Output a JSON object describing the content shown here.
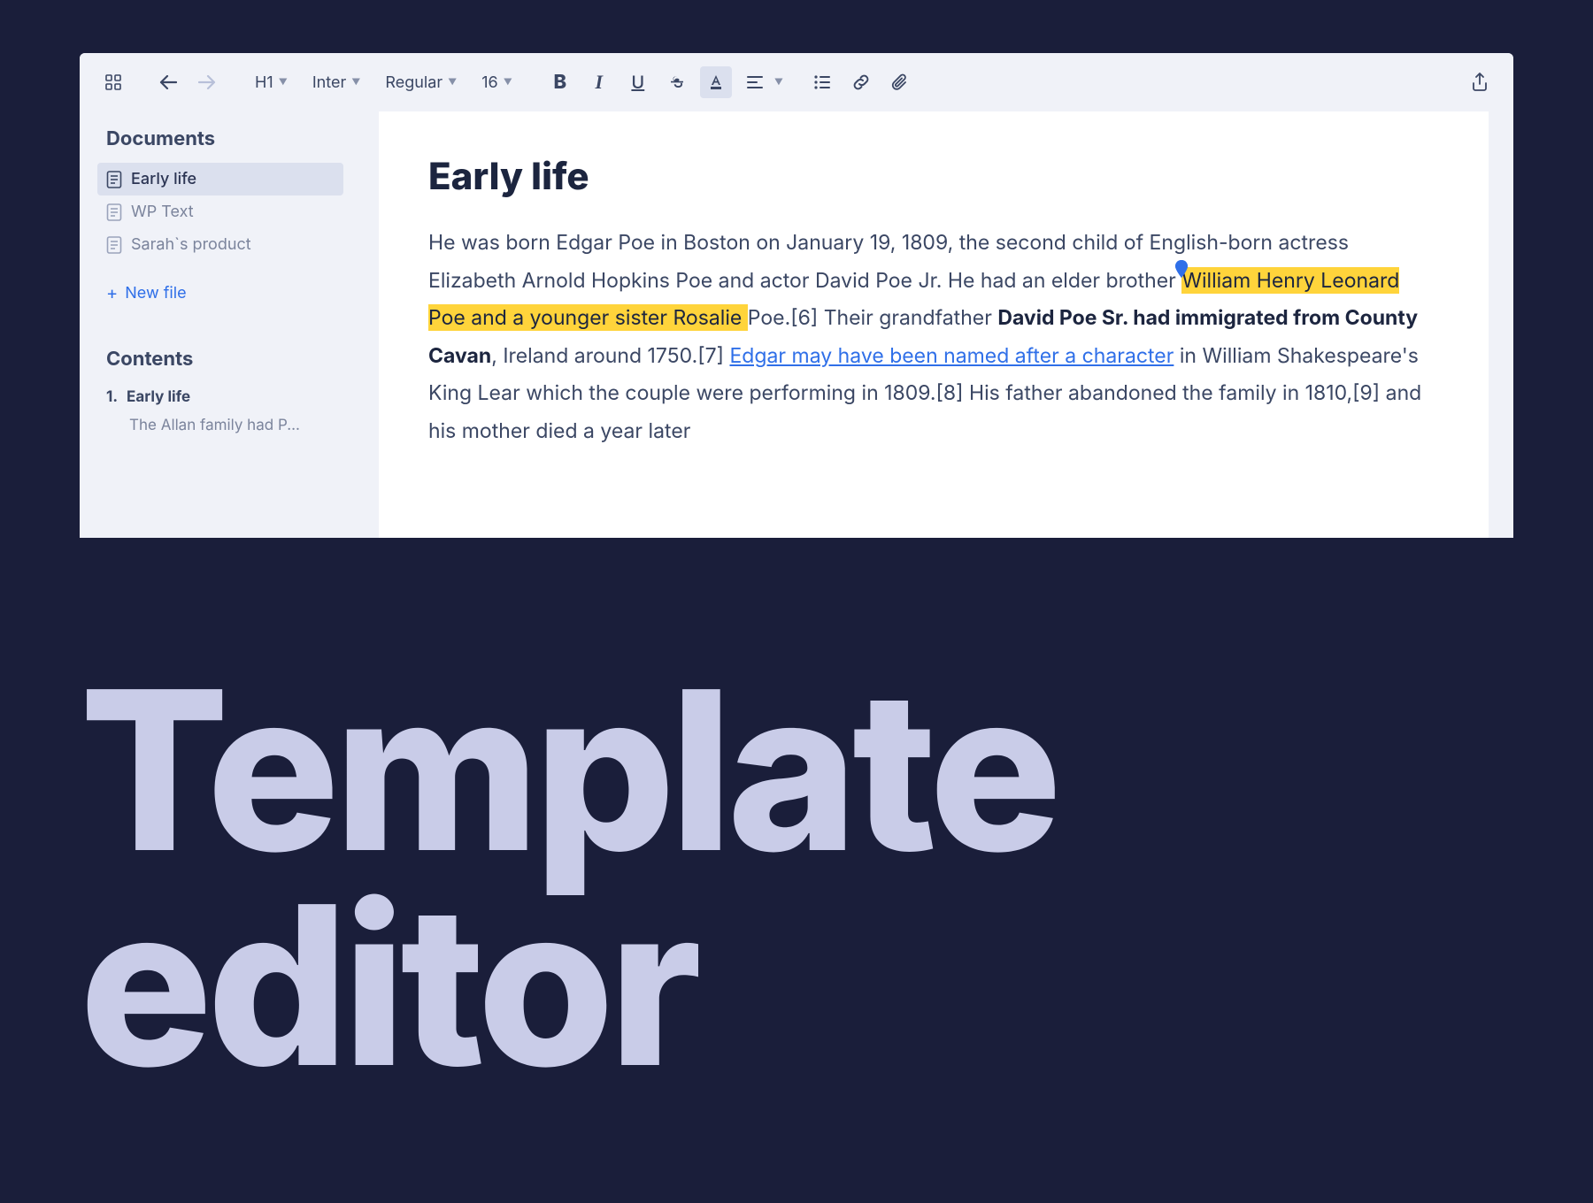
{
  "toolbar": {
    "heading_style": "H1",
    "font_family": "Inter",
    "font_weight": "Regular",
    "font_size": "16"
  },
  "sidebar": {
    "documents_heading": "Documents",
    "documents": [
      {
        "label": "Early life",
        "selected": true
      },
      {
        "label": "WP Text",
        "selected": false
      },
      {
        "label": "Sarah`s product",
        "selected": false
      }
    ],
    "new_file_label": "New file",
    "contents_heading": "Contents",
    "contents": [
      {
        "number": "1.",
        "label": "Early life",
        "bold": true
      },
      {
        "sub": "The Allan family had P..."
      }
    ]
  },
  "document": {
    "title": "Early life",
    "body": {
      "pre_highlight": "He was born Edgar Poe in Boston on January 19, 1809, the second child of English-born actress Elizabeth Arnold Hopkins Poe and actor David Poe Jr. He had an elder brother ",
      "highlight": "William Henry Leonard Poe and a younger sister Rosalie ",
      "after_highlight_1": "Poe.[6] Their grandfather ",
      "bold": "David Poe Sr. had immigrated from County Cavan",
      "after_bold": ", Ireland around 1750.[7] ",
      "link": "Edgar may have been named after a character",
      "after_link": " in William Shakespeare's King Lear which the couple were performing in 1809.[8] His father abandoned the family in 1810,[9] and his mother died a year later"
    }
  },
  "hero": {
    "line1": "Template",
    "line2": "editor"
  }
}
